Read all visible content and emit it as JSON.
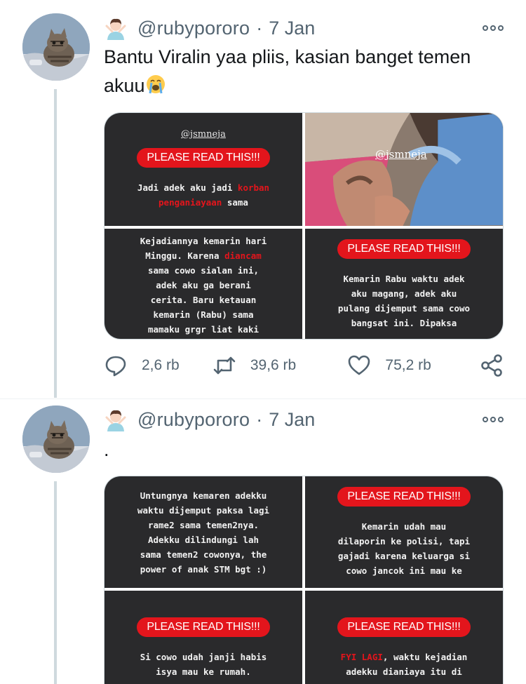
{
  "tweets": [
    {
      "handle": "@rubypororo",
      "separator": "·",
      "date": "7 Jan",
      "text_line1": "Bantu Viralin yaa pliis, kasian banget temen",
      "text_line2": "akuu",
      "media": {
        "tile1": {
          "watermark": "@jsmneja",
          "pill": "PLEASE READ THIS!!!",
          "line1": "Jadi adek aku jadi ",
          "line1_red": "korban",
          "line2_red": "penganiayaan",
          "line2": " sama"
        },
        "tile2": {
          "watermark": "@jsmneja"
        },
        "tile3": {
          "line1": "Kejadiannya kemarin hari",
          "line2a": "Minggu. Karena ",
          "line2_red": "diancam",
          "line3": "sama cowo sialan ini,",
          "line4": "adek aku ga berani",
          "line5": "cerita. Baru ketauan",
          "line6": "kemarin (Rabu) sama",
          "line7": "mamaku grgr liat kaki"
        },
        "tile4": {
          "pill": "PLEASE READ THIS!!!",
          "line1": "Kemarin Rabu waktu adek",
          "line2": "aku magang, adek aku",
          "line3": "pulang dijemput sama cowo",
          "line4": "bangsat ini. Dipaksa"
        }
      },
      "replies": "2,6 rb",
      "retweets": "39,6 rb",
      "likes": "75,2 rb"
    },
    {
      "handle": "@rubypororo",
      "separator": "·",
      "date": "7 Jan",
      "text": ".",
      "media": {
        "tile1": {
          "line1": "Untungnya kemaren adekku",
          "line2": "waktu dijemput paksa lagi",
          "line3": "rame2 sama temen2nya.",
          "line4": "Adekku dilindungi lah",
          "line5": "sama temen2 cowonya, the",
          "line6": "power of anak STM bgt :)"
        },
        "tile2": {
          "pill": "PLEASE READ THIS!!!",
          "line1": "Kemarin udah mau",
          "line2": "dilaporin ke polisi, tapi",
          "line3": "gajadi karena keluarga si",
          "line4": "cowo jancok ini mau ke"
        },
        "tile3": {
          "pill": "PLEASE READ THIS!!!",
          "line1": "Si cowo udah janji habis",
          "line2": "isya mau ke rumah."
        },
        "tile4": {
          "pill": "PLEASE READ THIS!!!",
          "line1_red": "FYI LAGI",
          "line1": ", waktu kejadian",
          "line2": "adekku dianiaya itu di"
        }
      }
    }
  ],
  "colors": {
    "secondary_text": "#536471",
    "pill_red": "#e3151c",
    "tile_dark": "#2a2a2c",
    "thread_line": "#cfd9de"
  },
  "icons": [
    "person-emoji-icon",
    "more-icon",
    "reply-icon",
    "retweet-icon",
    "like-icon",
    "share-icon",
    "loudly-crying-emoji-icon"
  ]
}
